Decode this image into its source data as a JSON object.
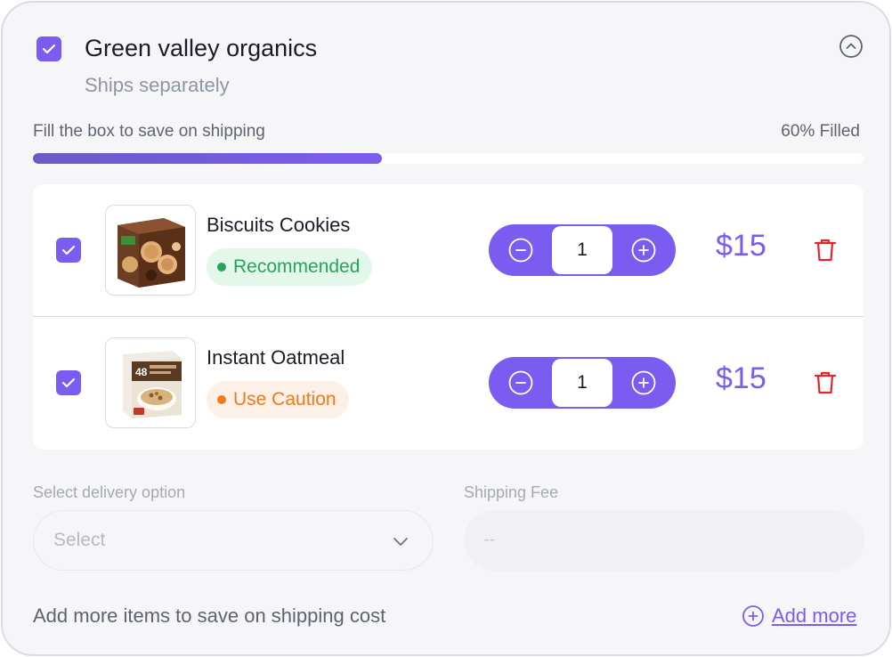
{
  "vendor": {
    "name": "Green valley organics",
    "subtitle": "Ships separately",
    "checked": true
  },
  "progress": {
    "label": "Fill the box to save on shipping",
    "status_text": "60% Filled",
    "fraction": 0.42
  },
  "items": [
    {
      "name": "Biscuits Cookies",
      "badge": "Recommended",
      "badge_type": "recommended",
      "quantity": "1",
      "price": "$15",
      "checked": true,
      "image": "cookie-box"
    },
    {
      "name": "Instant Oatmeal",
      "badge": "Use Caution",
      "badge_type": "caution",
      "quantity": "1",
      "price": "$15",
      "checked": true,
      "image": "oatmeal-box",
      "image_text": "48"
    }
  ],
  "delivery": {
    "label": "Select delivery option",
    "placeholder": "Select"
  },
  "shipping_fee": {
    "label": "Shipping Fee",
    "value": "--"
  },
  "footer": {
    "hint": "Add more items to save on shipping cost",
    "add_more_label": "Add more"
  },
  "colors": {
    "accent": "#7B5CF0",
    "recommended": "#23A55E",
    "caution": "#EE7A1E",
    "delete": "#E5252A"
  }
}
